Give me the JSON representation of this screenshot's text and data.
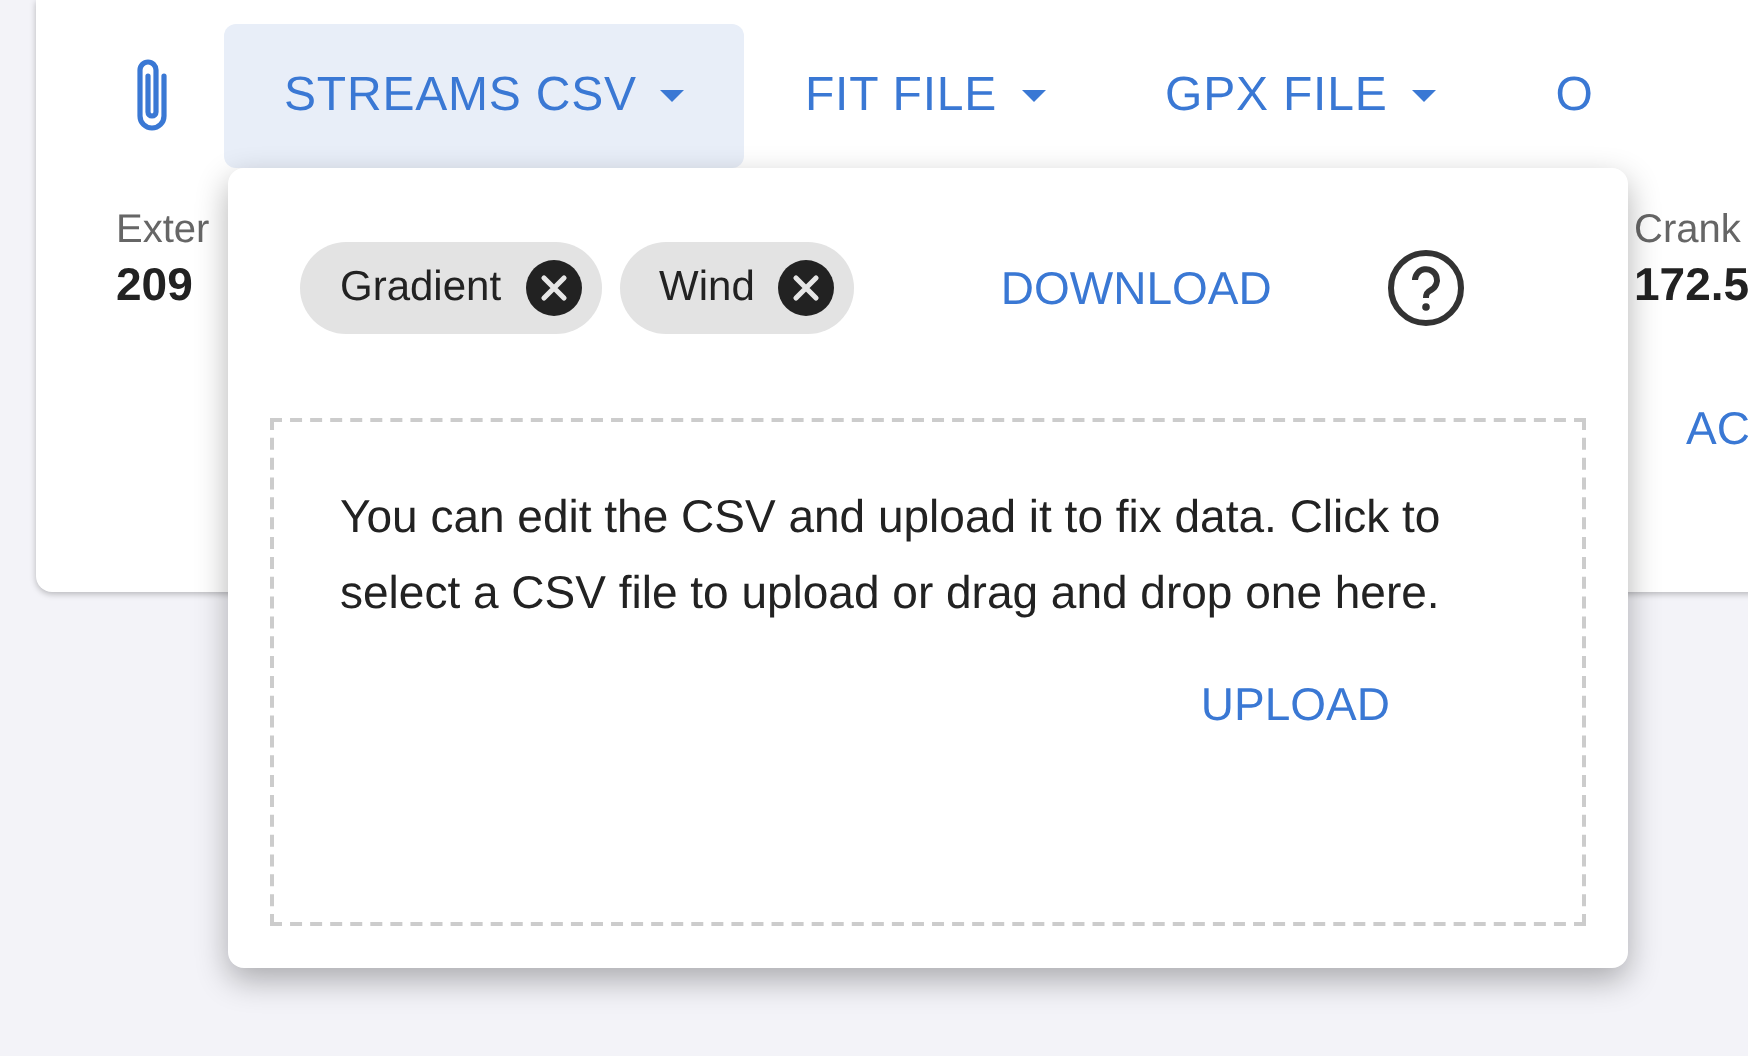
{
  "toolbar": {
    "tabs": [
      {
        "label": "STREAMS CSV",
        "selected": true,
        "has_caret": true
      },
      {
        "label": "FIT FILE",
        "selected": false,
        "has_caret": true
      },
      {
        "label": "GPX FILE",
        "selected": false,
        "has_caret": true
      },
      {
        "label": "O",
        "selected": false,
        "has_caret": false
      }
    ]
  },
  "stats": [
    {
      "label": "Exter",
      "value": "209"
    },
    {
      "label": "Crank",
      "value": "172.5"
    }
  ],
  "side_action": "AC",
  "popup": {
    "chips": [
      {
        "label": "Gradient"
      },
      {
        "label": "Wind"
      }
    ],
    "download": "DOWNLOAD",
    "dropzone": {
      "text": "You can edit the CSV and upload it to fix data. Click to select a CSV file to upload or drag and drop one here.",
      "action": "UPLOAD"
    }
  }
}
